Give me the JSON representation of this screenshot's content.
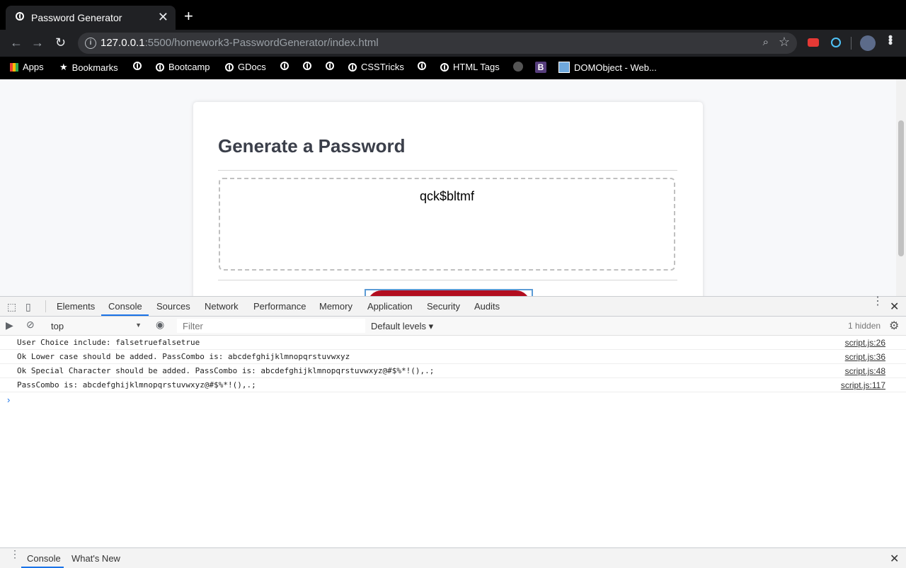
{
  "browser": {
    "tab_title": "Password Generator",
    "tab_close": "✕",
    "new_tab": "+",
    "url_host": "127.0.0.1",
    "url_rest": ":5500/homework3-PasswordGenerator/index.html",
    "bookmarks": [
      "Apps",
      "Bookmarks",
      "Bootcamp",
      "GDocs",
      "CSSTricks",
      "HTML Tags",
      "DOMObject - Web..."
    ]
  },
  "page": {
    "heading": "Generate a Password",
    "password": "qck$bltmf"
  },
  "devtools": {
    "tabs": [
      "Elements",
      "Console",
      "Sources",
      "Network",
      "Performance",
      "Memory",
      "Application",
      "Security",
      "Audits"
    ],
    "active_tab": "Console",
    "context": "top",
    "filter_placeholder": "Filter",
    "levels": "Default levels ▾",
    "hidden": "1 hidden",
    "logs": [
      {
        "msg": "User Choice include: falsetruefalsetrue",
        "src": "script.js:26"
      },
      {
        "msg": "Ok Lower case should be added. PassCombo is: abcdefghijklmnopqrstuvwxyz",
        "src": "script.js:36"
      },
      {
        "msg": "Ok Special Character should be added. PassCombo is: abcdefghijklmnopqrstuvwxyz@#$%*!(),.;",
        "src": "script.js:48"
      },
      {
        "msg": "PassCombo is: abcdefghijklmnopqrstuvwxyz@#$%*!(),.;",
        "src": "script.js:117"
      }
    ],
    "drawer_tabs": [
      "Console",
      "What's New"
    ]
  },
  "colors": {
    "generate_button": "#b20d1f",
    "devtools_accent": "#1a73e8"
  }
}
